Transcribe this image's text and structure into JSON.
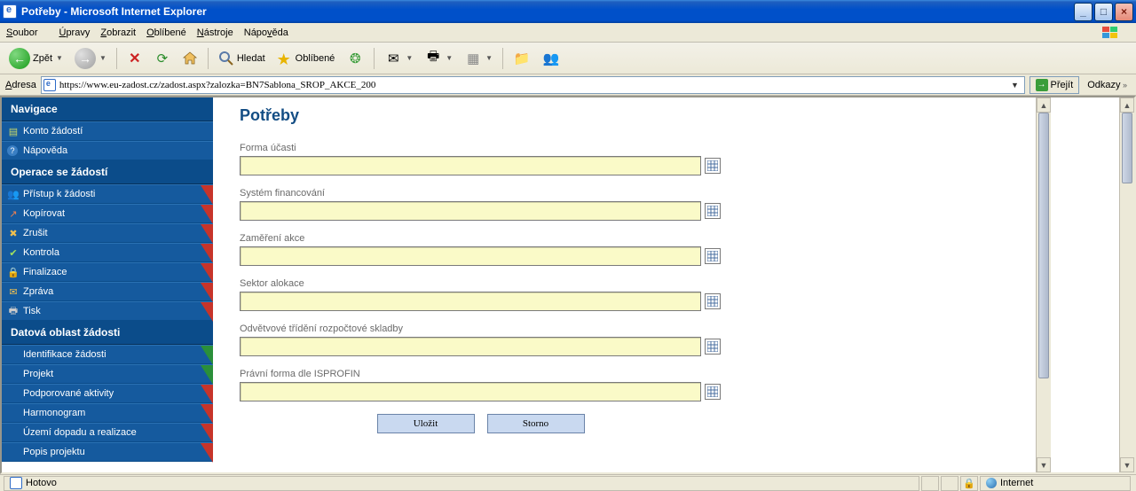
{
  "window": {
    "title": "Potřeby - Microsoft Internet Explorer"
  },
  "menu": {
    "items": [
      "Soubor",
      "Úpravy",
      "Zobrazit",
      "Oblíbené",
      "Nástroje",
      "Nápověda"
    ]
  },
  "toolbar": {
    "back": "Zpět",
    "search": "Hledat",
    "favorites": "Oblíbené"
  },
  "address": {
    "label": "Adresa",
    "url": "https://www.eu-zadost.cz/zadost.aspx?zalozka=BN7Sablona_SROP_AKCE_200",
    "go": "Přejít",
    "links": "Odkazy"
  },
  "sidebar": {
    "nav_header": "Navigace",
    "nav_items": [
      {
        "label": "Konto žádostí",
        "icon": "📋"
      },
      {
        "label": "Nápověda",
        "icon": "?"
      }
    ],
    "ops_header": "Operace se žádostí",
    "ops_items": [
      {
        "label": "Přístup k žádosti",
        "icon": "👥",
        "corner": "red"
      },
      {
        "label": "Kopírovat",
        "icon": "↗",
        "corner": "red"
      },
      {
        "label": "Zrušit",
        "icon": "✖",
        "corner": "red"
      },
      {
        "label": "Kontrola",
        "icon": "✔",
        "corner": "red"
      },
      {
        "label": "Finalizace",
        "icon": "🔒",
        "corner": "red"
      },
      {
        "label": "Zpráva",
        "icon": "✉",
        "corner": "red"
      },
      {
        "label": "Tisk",
        "icon": "🖶",
        "corner": "red"
      }
    ],
    "data_header": "Datová oblast žádosti",
    "data_items": [
      {
        "label": "Identifikace žádosti",
        "corner": "green"
      },
      {
        "label": "Projekt",
        "corner": "green"
      },
      {
        "label": "Podporované aktivity",
        "corner": "red"
      },
      {
        "label": "Harmonogram",
        "corner": "red"
      },
      {
        "label": "Území dopadu a realizace",
        "corner": "red"
      },
      {
        "label": "Popis projektu",
        "corner": "red"
      }
    ]
  },
  "main": {
    "title": "Potřeby",
    "fields": [
      {
        "label": "Forma účasti"
      },
      {
        "label": "Systém financování"
      },
      {
        "label": "Zaměření akce"
      },
      {
        "label": "Sektor alokace"
      },
      {
        "label": "Odvětvové třídění rozpočtové skladby"
      },
      {
        "label": "Právní forma dle ISPROFIN"
      }
    ],
    "save": "Uložit",
    "cancel": "Storno"
  },
  "status": {
    "text": "Hotovo",
    "zone": "Internet"
  }
}
